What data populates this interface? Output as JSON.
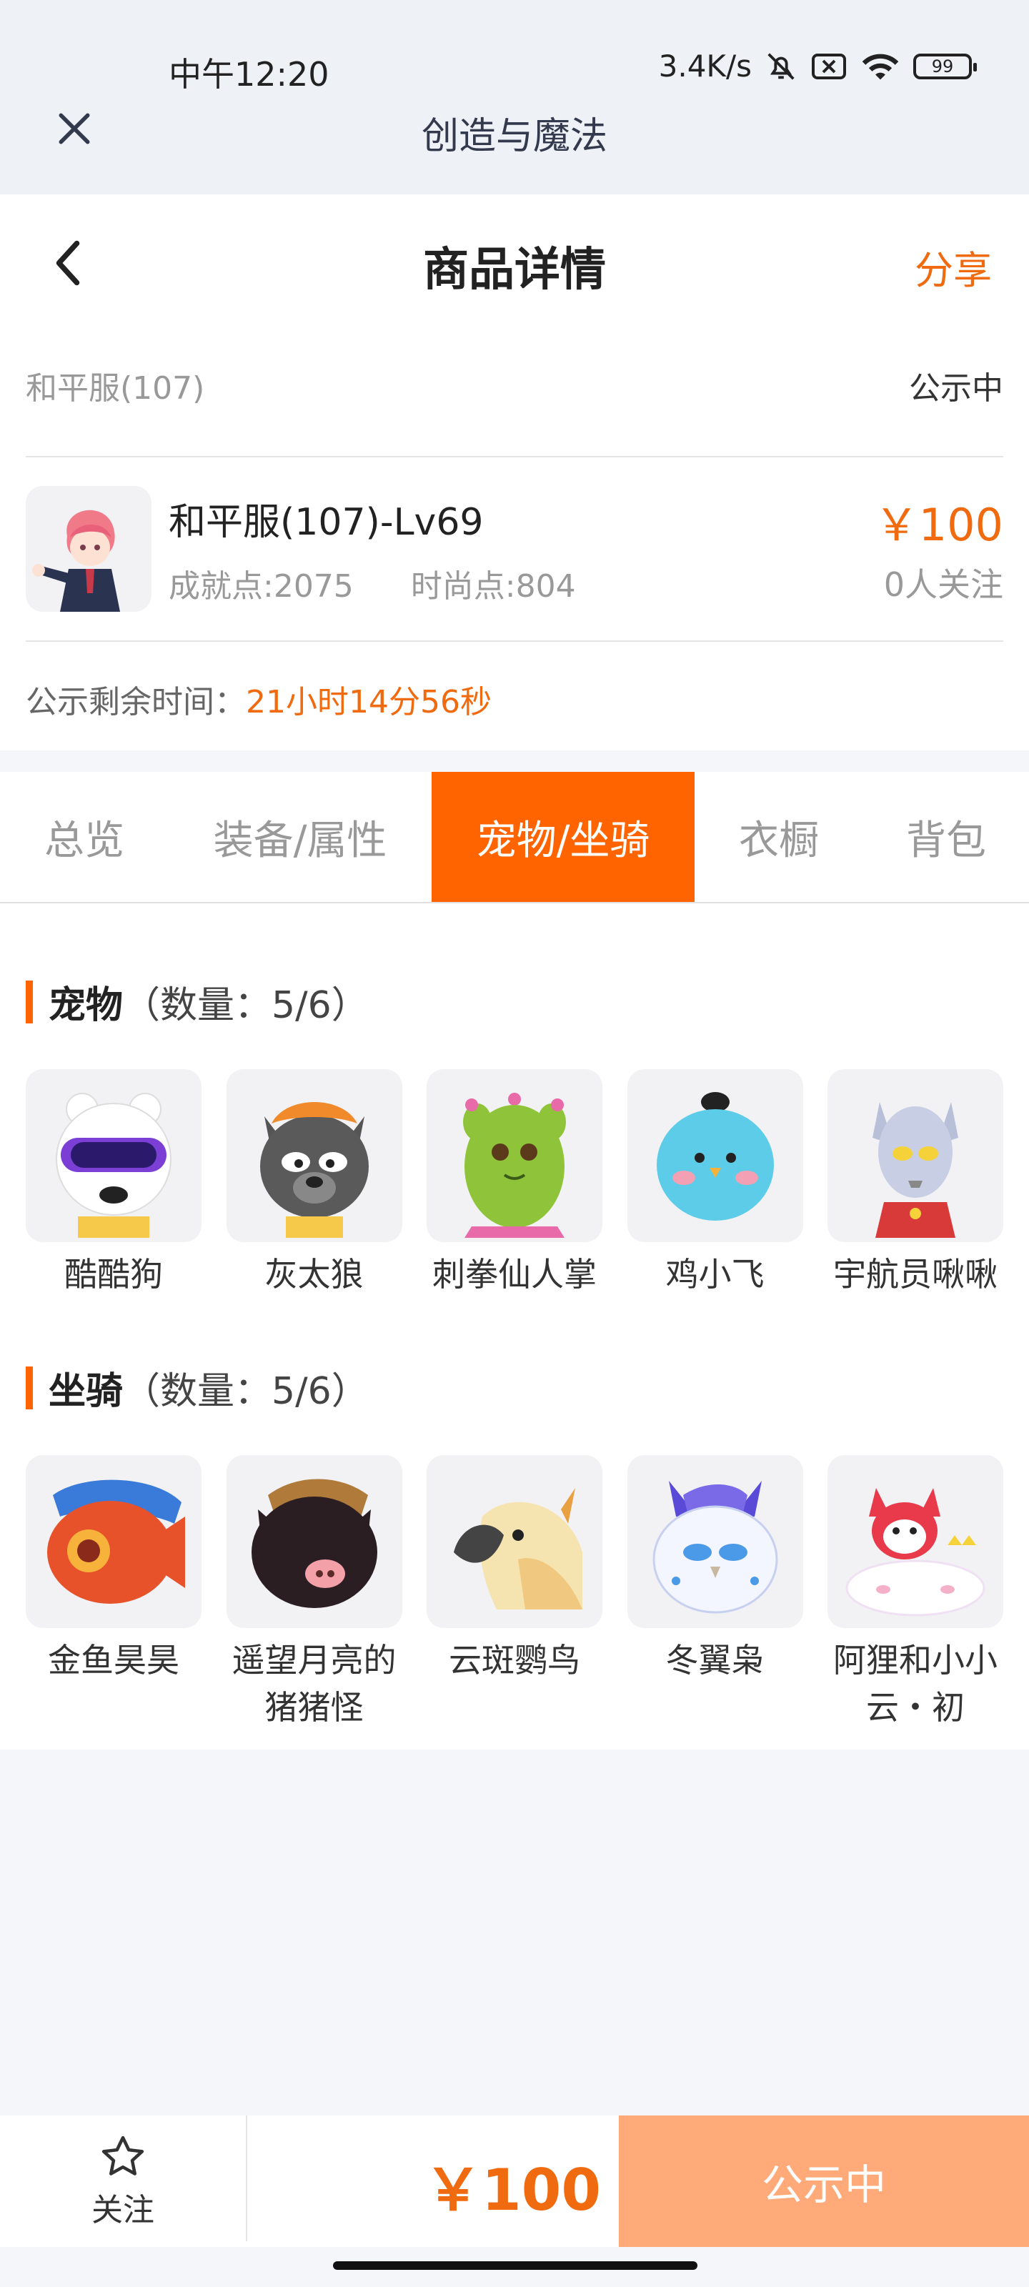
{
  "status_bar": {
    "time": "中午12:20",
    "network_speed": "3.4K/s",
    "battery": "99",
    "icons": [
      "bell-muted-icon",
      "sim-off-icon",
      "wifi-icon",
      "battery-icon"
    ]
  },
  "app_bar": {
    "title": "创造与魔法",
    "close_icon": "close-icon"
  },
  "page_header": {
    "title": "商品详情",
    "share_label": "分享",
    "back_icon": "back-chevron-icon"
  },
  "product": {
    "server": "和平服(107)",
    "status": "公示中",
    "name": "和平服(107)-Lv69",
    "achievement": "成就点:2075",
    "fashion": "时尚点:804",
    "price": "￥100",
    "followers": "0人关注",
    "remain_label": "公示剩余时间：",
    "remain_value": "21小时14分56秒"
  },
  "tabs": [
    {
      "label": "总览",
      "active": false
    },
    {
      "label": "装备/属性",
      "active": false
    },
    {
      "label": "宠物/坐骑",
      "active": true
    },
    {
      "label": "衣橱",
      "active": false
    },
    {
      "label": "背包",
      "active": false
    }
  ],
  "pets": {
    "title": "宠物",
    "count": "（数量：5/6）",
    "items": [
      {
        "name": "酷酷狗",
        "icon": "cool-dog-icon"
      },
      {
        "name": "灰太狼",
        "icon": "grey-wolf-icon"
      },
      {
        "name": "刺拳仙人掌",
        "icon": "cactus-icon"
      },
      {
        "name": "鸡小飞",
        "icon": "blue-chick-icon"
      },
      {
        "name": "宇航员啾啾",
        "icon": "astronaut-hero-icon"
      }
    ]
  },
  "mounts": {
    "title": "坐骑",
    "count": "（数量：5/6）",
    "items": [
      {
        "name": "金鱼昊昊",
        "icon": "goldfish-icon"
      },
      {
        "name": "遥望月亮的猪猪怪",
        "icon": "pig-monster-icon"
      },
      {
        "name": "云斑鹦鸟",
        "icon": "parrot-icon"
      },
      {
        "name": "冬翼枭",
        "icon": "winter-owl-icon"
      },
      {
        "name": "阿狸和小小云・初",
        "icon": "fox-cloud-icon"
      }
    ]
  },
  "bottom_bar": {
    "follow_label": "关注",
    "price": "￥100",
    "status_button": "公示中"
  },
  "colors": {
    "accent": "#ff6400",
    "price": "#f06a0f",
    "button_disabled": "#ffaa78"
  }
}
